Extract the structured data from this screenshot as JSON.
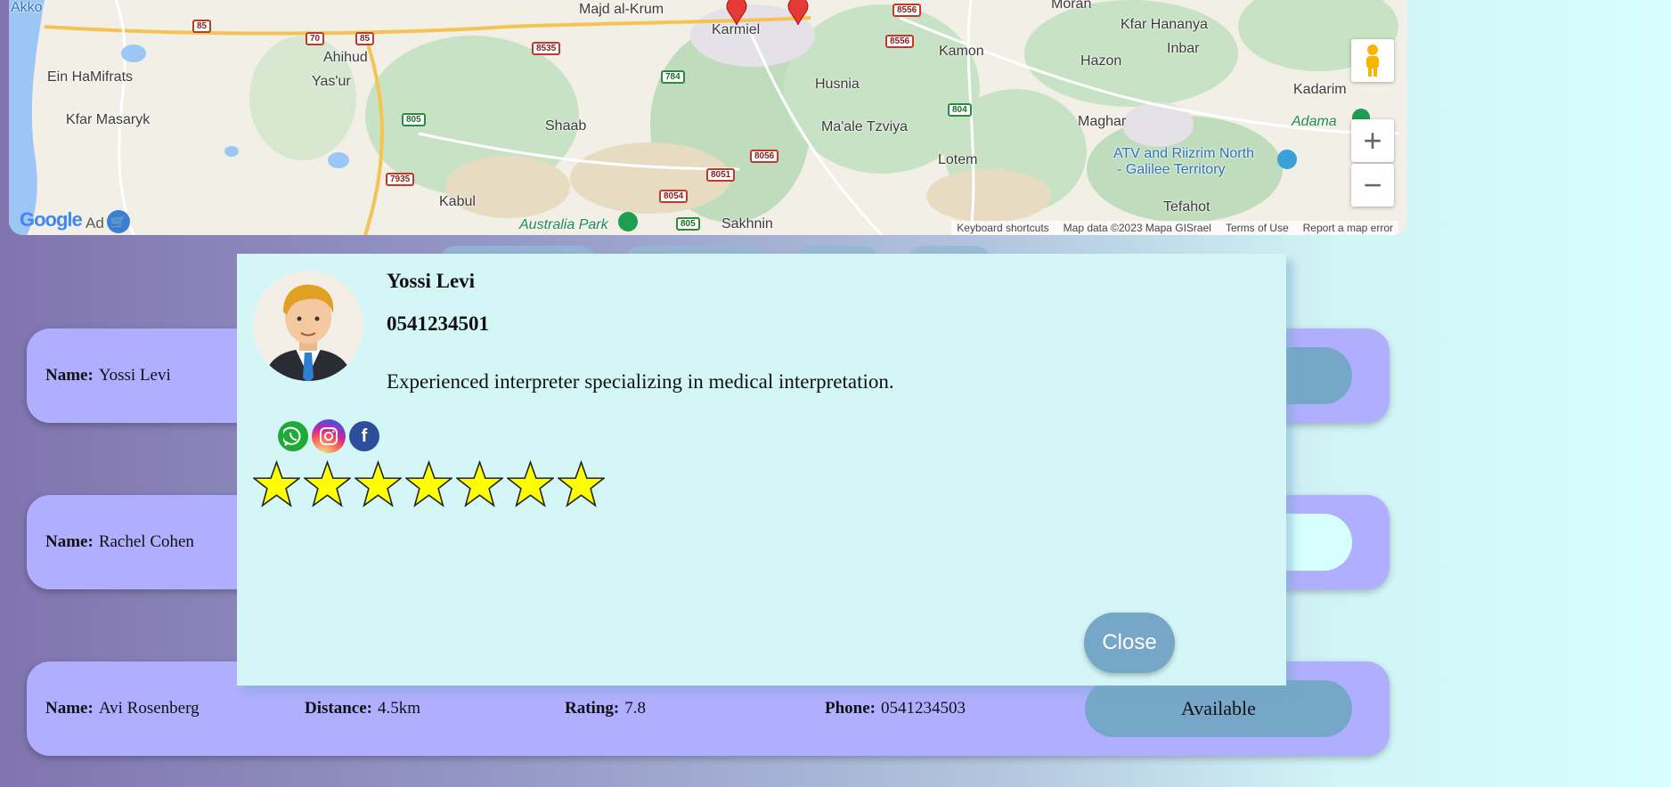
{
  "map": {
    "places": [
      {
        "name": "Akko",
        "style": "blue"
      },
      {
        "name": "Majd al-Krum",
        "style": ""
      },
      {
        "name": "Moran",
        "style": ""
      },
      {
        "name": "Kfar Hananya",
        "style": ""
      },
      {
        "name": "Ahihud",
        "style": ""
      },
      {
        "name": "Karmiel",
        "style": ""
      },
      {
        "name": "Kamon",
        "style": ""
      },
      {
        "name": "Inbar",
        "style": ""
      },
      {
        "name": "Ein HaMifrats",
        "style": ""
      },
      {
        "name": "Yas'ur",
        "style": ""
      },
      {
        "name": "Husnia",
        "style": ""
      },
      {
        "name": "Hazon",
        "style": ""
      },
      {
        "name": "Kadarim",
        "style": ""
      },
      {
        "name": "Kfar Masaryk",
        "style": ""
      },
      {
        "name": "Shaab",
        "style": ""
      },
      {
        "name": "Ma'ale Tzviya",
        "style": ""
      },
      {
        "name": "Maghar",
        "style": ""
      },
      {
        "name": "Adama",
        "style": "green"
      },
      {
        "name": "Lotem",
        "style": ""
      },
      {
        "name": "ATV and Riizrim North",
        "style": "blue"
      },
      {
        "name": "- Galilee Territory",
        "style": "blue"
      },
      {
        "name": "Kabul",
        "style": ""
      },
      {
        "name": "Tefahot",
        "style": ""
      },
      {
        "name": "Australia Park",
        "style": "green"
      },
      {
        "name": "Sakhnin",
        "style": ""
      }
    ],
    "roads": [
      {
        "label": "85",
        "type": "r"
      },
      {
        "label": "70",
        "type": "r"
      },
      {
        "label": "85",
        "type": "r"
      },
      {
        "label": "8535",
        "type": "r"
      },
      {
        "label": "8556",
        "type": "r"
      },
      {
        "label": "8556",
        "type": "r"
      },
      {
        "label": "784",
        "type": "g"
      },
      {
        "label": "804",
        "type": "g"
      },
      {
        "label": "805",
        "type": "g"
      },
      {
        "label": "8056",
        "type": "r"
      },
      {
        "label": "8051",
        "type": "r"
      },
      {
        "label": "7935",
        "type": "r"
      },
      {
        "label": "8054",
        "type": "r"
      },
      {
        "label": "805",
        "type": "g"
      }
    ],
    "logo": "Google",
    "ad": "Ad",
    "attribution": [
      "Keyboard shortcuts",
      "Map data ©2023 Mapa GISrael",
      "Terms of Use",
      "Report a map error"
    ],
    "zoom_in": "+",
    "zoom_out": "−"
  },
  "labels": {
    "name": "Name:",
    "distance": "Distance:",
    "rating": "Rating:",
    "phone": "Phone:"
  },
  "interpreters": [
    {
      "name": "Yossi Levi"
    },
    {
      "name": "Rachel Cohen"
    },
    {
      "name": "Avi Rosenberg",
      "distance": "4.5km",
      "rating": "7.8",
      "phone": "0541234503",
      "status": "Available"
    }
  ],
  "modal": {
    "name": "Yossi Levi",
    "phone": "0541234501",
    "description": "Experienced interpreter specializing in medical interpretation.",
    "socials": [
      "whatsapp",
      "instagram",
      "facebook"
    ],
    "stars": 7,
    "close_label": "Close"
  },
  "colors": {
    "card": "#b0aefe",
    "button": "#76a6c8",
    "modal": "#d4f6f7",
    "star": "#ffff00"
  }
}
